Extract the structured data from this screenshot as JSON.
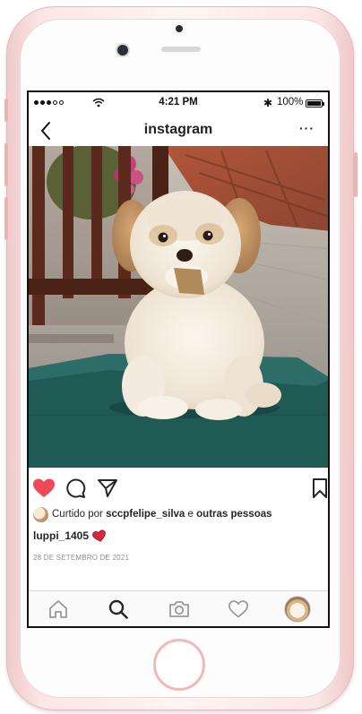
{
  "status_bar": {
    "time": "4:21 PM",
    "battery_percent": "100%",
    "bluetooth_glyph": "✱",
    "signal_bars_filled": 3
  },
  "header": {
    "title": "instagram",
    "back_icon": "chevron-left-icon",
    "more_label": "···"
  },
  "post": {
    "image_subject": "dog photo",
    "liked": true,
    "like_color": "#ed4956",
    "liked_by_prefix": "Curtido por",
    "liked_by_user": "sccpfelipe_silva",
    "liked_by_connector": "e",
    "liked_by_suffix": "outras pessoas",
    "username": "luppi_1405",
    "caption_emoji": "heart-icon",
    "date": "28 DE SETEMBRO DE 2021"
  },
  "tab_bar": {
    "items": [
      "home-icon",
      "search-icon",
      "camera-icon",
      "heart-icon",
      "profile-avatar"
    ],
    "active": "search-icon"
  },
  "colors": {
    "phone_frame": "#f6d4d4",
    "like_red": "#ed4956",
    "text": "#262626",
    "meta_gray": "#8e8e8e"
  }
}
